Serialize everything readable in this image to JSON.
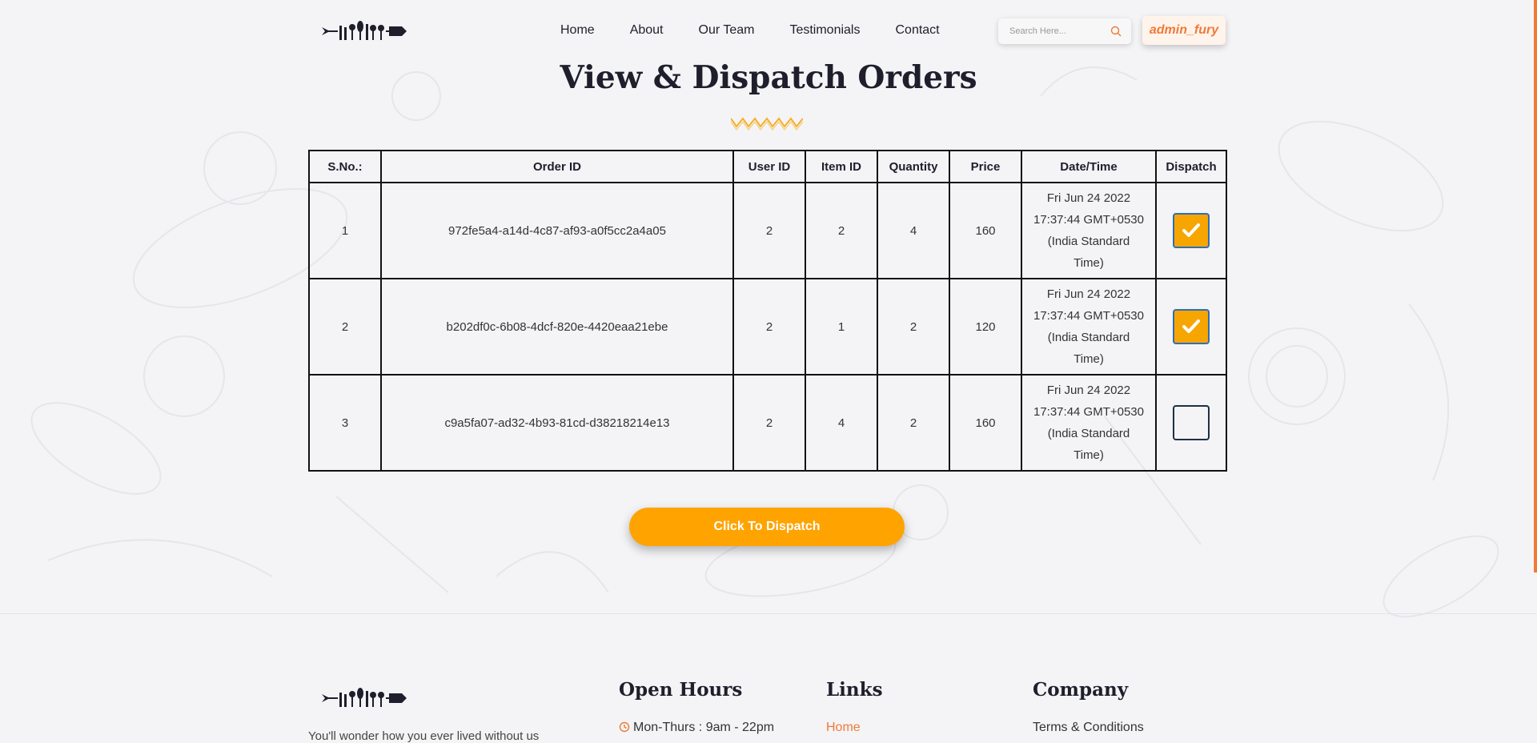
{
  "header": {
    "nav": [
      "Home",
      "About",
      "Our Team",
      "Testimonials",
      "Contact"
    ],
    "search_placeholder": "Search Here...",
    "username": "admin_fury"
  },
  "page": {
    "title": "View & Dispatch Orders"
  },
  "table": {
    "headers": [
      "S.No.:",
      "Order ID",
      "User ID",
      "Item ID",
      "Quantity",
      "Price",
      "Date/Time",
      "Dispatch"
    ],
    "rows": [
      {
        "sno": "1",
        "order_id": "972fe5a4-a14d-4c87-af93-a0f5cc2a4a05",
        "user_id": "2",
        "item_id": "2",
        "quantity": "4",
        "price": "160",
        "datetime": [
          "Fri Jun 24 2022",
          "17:37:44 GMT+0530",
          "(India Standard",
          "Time)"
        ],
        "dispatch": true
      },
      {
        "sno": "2",
        "order_id": "b202df0c-6b08-4dcf-820e-4420eaa21ebe",
        "user_id": "2",
        "item_id": "1",
        "quantity": "2",
        "price": "120",
        "datetime": [
          "Fri Jun 24 2022",
          "17:37:44 GMT+0530",
          "(India Standard",
          "Time)"
        ],
        "dispatch": true
      },
      {
        "sno": "3",
        "order_id": "c9a5fa07-ad32-4b93-81cd-d38218214e13",
        "user_id": "2",
        "item_id": "4",
        "quantity": "2",
        "price": "160",
        "datetime": [
          "Fri Jun 24 2022",
          "17:37:44 GMT+0530",
          "(India Standard",
          "Time)"
        ],
        "dispatch": false
      }
    ]
  },
  "dispatch_button": "Click To Dispatch",
  "footer": {
    "tagline": "You'll wonder how you ever lived without us",
    "open_hours": {
      "title": "Open Hours",
      "line1": "Mon-Thurs : 9am - 22pm"
    },
    "links": {
      "title": "Links",
      "item1": "Home"
    },
    "company": {
      "title": "Company",
      "item1": "Terms & Conditions"
    }
  },
  "colors": {
    "accent": "#f07a36",
    "button": "#ffa300",
    "check_fill": "#f7a500",
    "zigzag": "#f5b027",
    "text": "#1e1e2c"
  },
  "icons": [
    "logo-icon",
    "search-icon",
    "check-icon",
    "clock-icon",
    "zigzag-icon"
  ]
}
